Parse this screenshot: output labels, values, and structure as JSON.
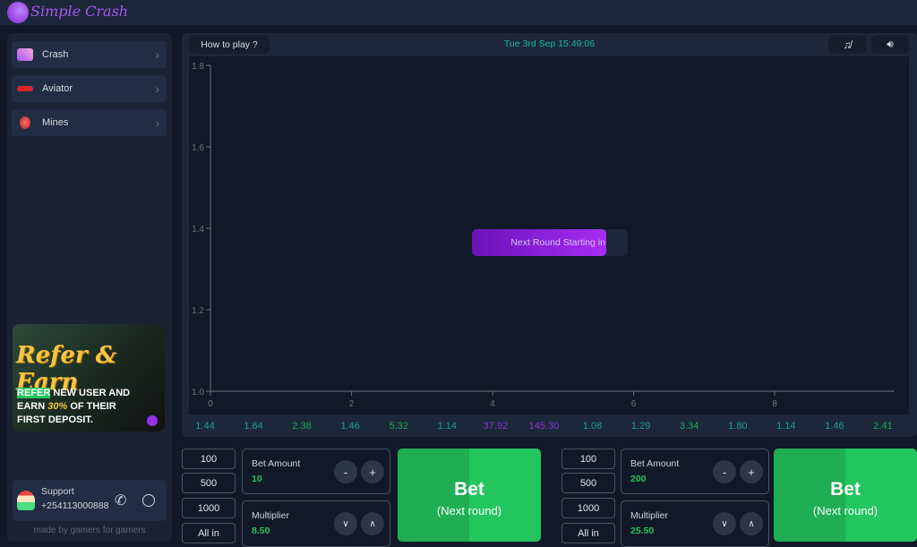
{
  "header": {
    "logo_text": "Simple Crash"
  },
  "sidebar": {
    "items": [
      {
        "label": "Crash",
        "icon": "comet-icon"
      },
      {
        "label": "Aviator",
        "icon": "plane-icon"
      },
      {
        "label": "Mines",
        "icon": "bomb-icon"
      }
    ],
    "banner": {
      "title": "Refer & Earn",
      "line1_highlight": "REFER",
      "line1": " NEW USER AND",
      "line2a": "EARN ",
      "line2_pct": "30%",
      "line2b": " OF THEIR",
      "line3": "FIRST DEPOSIT."
    },
    "support": {
      "label": "Support",
      "phone": "+254113000888"
    },
    "footer": "made by gamers for gamers"
  },
  "topbar": {
    "how_to_play": "How to play ?",
    "datetime": "Tue 3rd Sep 15:49:06"
  },
  "chart_data": {
    "type": "line",
    "x_ticks": [
      "0",
      "2",
      "4",
      "6",
      "8"
    ],
    "y_ticks": [
      "1.0",
      "1.2",
      "1.4",
      "1.6",
      "1.8"
    ],
    "xlim": [
      0,
      9.7
    ],
    "ylim": [
      1.0,
      1.8
    ],
    "values": []
  },
  "countdown": {
    "label": "Next Round Starting in",
    "progress": 0.86
  },
  "history": [
    {
      "v": "1.44",
      "c": "#1a9e9a"
    },
    {
      "v": "1.64",
      "c": "#1a9e9a"
    },
    {
      "v": "2.38",
      "c": "#22a55a"
    },
    {
      "v": "1.46",
      "c": "#1a9e9a"
    },
    {
      "v": "5.32",
      "c": "#22a55a"
    },
    {
      "v": "1.14",
      "c": "#1a9e9a"
    },
    {
      "v": "37.92",
      "c": "#8b34d8"
    },
    {
      "v": "145.30",
      "c": "#8b34d8"
    },
    {
      "v": "1.08",
      "c": "#1a9e9a"
    },
    {
      "v": "1.29",
      "c": "#1a9e9a"
    },
    {
      "v": "3.34",
      "c": "#22a55a"
    },
    {
      "v": "1.80",
      "c": "#1a9e9a"
    },
    {
      "v": "1.14",
      "c": "#1a9e9a"
    },
    {
      "v": "1.46",
      "c": "#1a9e9a"
    },
    {
      "v": "2.41",
      "c": "#22a55a"
    }
  ],
  "bets": [
    {
      "quick": [
        "100",
        "500",
        "1000",
        "All in"
      ],
      "amount_label": "Bet Amount",
      "amount": "10",
      "multiplier_label": "Multiplier",
      "multiplier": "8.50",
      "bet": "Bet",
      "sub": "(Next round)"
    },
    {
      "quick": [
        "100",
        "500",
        "1000",
        "All in"
      ],
      "amount_label": "Bet Amount",
      "amount": "200",
      "multiplier_label": "Multiplier",
      "multiplier": "25.50",
      "bet": "Bet",
      "sub": "(Next round)"
    }
  ]
}
